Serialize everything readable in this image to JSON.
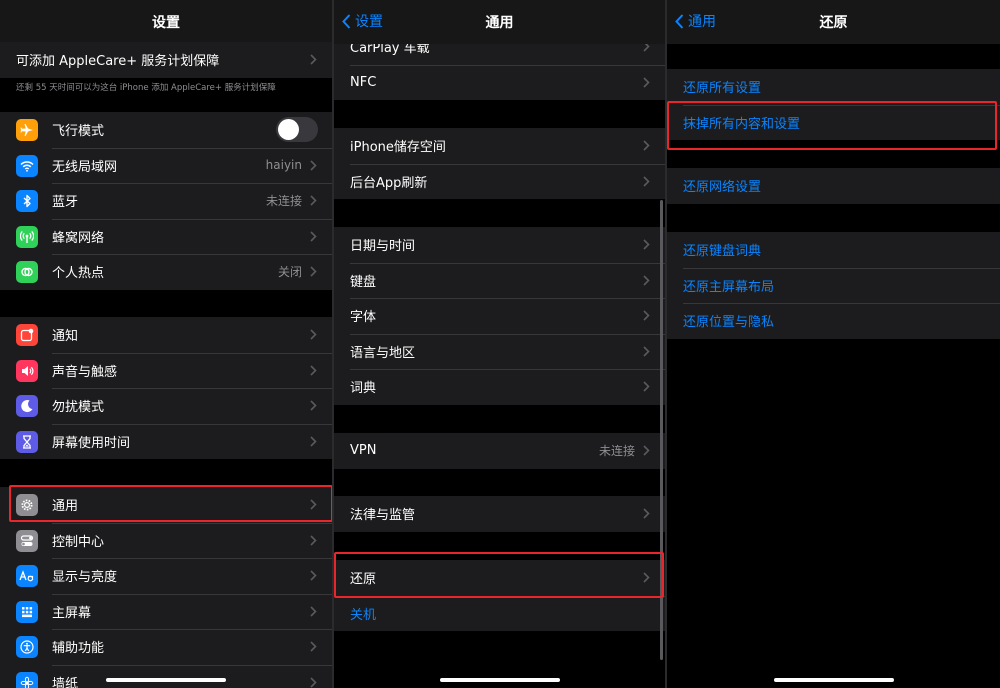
{
  "settings": {
    "title": "设置",
    "applecare_label": "可添加 AppleCare+ 服务计划保障",
    "applecare_note": "还剩 55 天时间可以为这台 iPhone 添加 AppleCare+ 服务计划保障",
    "connectivity": [
      {
        "label": "飞行模式",
        "value": "",
        "icon": "airplane-icon",
        "color": "#ff9f0a"
      },
      {
        "label": "无线局域网",
        "value": "haiyin",
        "icon": "wifi-icon",
        "color": "#0a84ff"
      },
      {
        "label": "蓝牙",
        "value": "未连接",
        "icon": "bluetooth-icon",
        "color": "#0a84ff"
      },
      {
        "label": "蜂窝网络",
        "value": "",
        "icon": "cellular-icon",
        "color": "#30d158"
      },
      {
        "label": "个人热点",
        "value": "关闭",
        "icon": "hotspot-icon",
        "color": "#30d158"
      }
    ],
    "alerts": [
      {
        "label": "通知",
        "icon": "notifications-icon",
        "color": "#ff453a"
      },
      {
        "label": "声音与触感",
        "icon": "speaker-icon",
        "color": "#ff375f"
      },
      {
        "label": "勿扰模式",
        "icon": "moon-icon",
        "color": "#5e5ce6"
      },
      {
        "label": "屏幕使用时间",
        "icon": "hourglass-icon",
        "color": "#5e5ce6"
      }
    ],
    "system": [
      {
        "label": "通用",
        "icon": "gear-icon",
        "color": "#8e8e93"
      },
      {
        "label": "控制中心",
        "icon": "control-center-icon",
        "color": "#8e8e93"
      },
      {
        "label": "显示与亮度",
        "icon": "display-brightness-icon",
        "color": "#0a84ff"
      },
      {
        "label": "主屏幕",
        "icon": "home-screen-icon",
        "color": "#0a84ff"
      },
      {
        "label": "辅助功能",
        "icon": "accessibility-icon",
        "color": "#0a84ff"
      },
      {
        "label": "墙纸",
        "icon": "wallpaper-icon",
        "color": "#0a84ff"
      }
    ]
  },
  "general": {
    "back": "设置",
    "title": "通用",
    "group1": [
      "CarPlay 车载",
      "NFC"
    ],
    "group2": [
      "iPhone储存空间",
      "后台App刷新"
    ],
    "group3": [
      "日期与时间",
      "键盘",
      "字体",
      "语言与地区",
      "词典"
    ],
    "vpn": {
      "label": "VPN",
      "value": "未连接"
    },
    "legal": "法律与监管",
    "reset": "还原",
    "shutdown": "关机"
  },
  "reset": {
    "back": "通用",
    "title": "还原",
    "group1": [
      "还原所有设置",
      "抹掉所有内容和设置"
    ],
    "group2": [
      "还原网络设置"
    ],
    "group3": [
      "还原键盘词典",
      "还原主屏幕布局",
      "还原位置与隐私"
    ]
  },
  "colors": {
    "accent": "#0a84ff",
    "highlight": "#e8262c",
    "cell": "#1c1c1e",
    "background": "#000000"
  }
}
